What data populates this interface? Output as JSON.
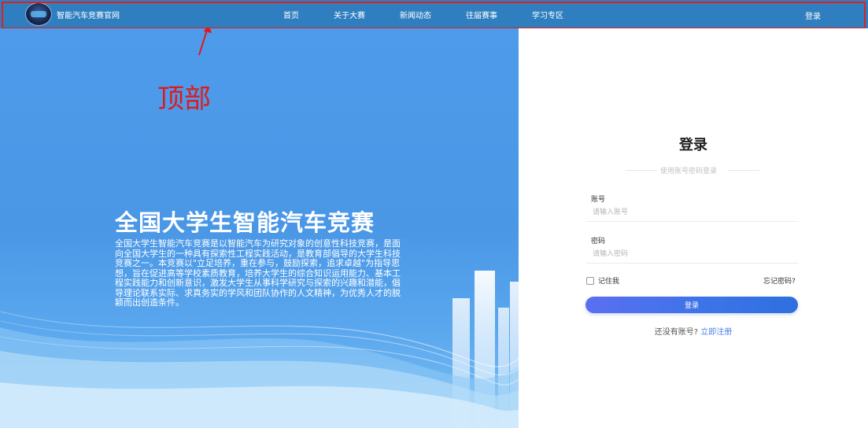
{
  "header": {
    "site_name": "智能汽车竞赛官网",
    "nav": [
      "首页",
      "关于大赛",
      "新闻动态",
      "往届赛事",
      "学习专区"
    ],
    "login": "登录"
  },
  "annotation": {
    "label": "顶部"
  },
  "hero": {
    "title": "全国大学生智能汽车竞赛",
    "description": "全国大学生智能汽车竞赛是以智能汽车为研究对象的创意性科技竞赛，是面向全国大学生的一种具有探索性工程实践活动，是教育部倡导的大学生科技竞赛之一。本竞赛以\"立足培养，重在参与，鼓励探索，追求卓越\"为指导思想，旨在促进高等学校素质教育，培养大学生的综合知识运用能力、基本工程实践能力和创新意识，激发大学生从事科学研究与探索的兴趣和潜能，倡导理论联系实际、求真务实的学风和团队协作的人文精神，为优秀人才的脱颖而出创造条件。"
  },
  "login_form": {
    "title": "登录",
    "subtitle": "使用账号密码登录",
    "account_label": "账号",
    "account_placeholder": "请输入账号",
    "password_label": "密码",
    "password_placeholder": "请输入密码",
    "remember_label": "记住我",
    "forgot_label": "忘记密码?",
    "submit_label": "登录",
    "register_prompt": "还没有账号?",
    "register_link": "立即注册"
  },
  "colors": {
    "header_bg": "#2f7fc0",
    "annotation": "#e01a1a",
    "accent": "#4b7ee8"
  }
}
